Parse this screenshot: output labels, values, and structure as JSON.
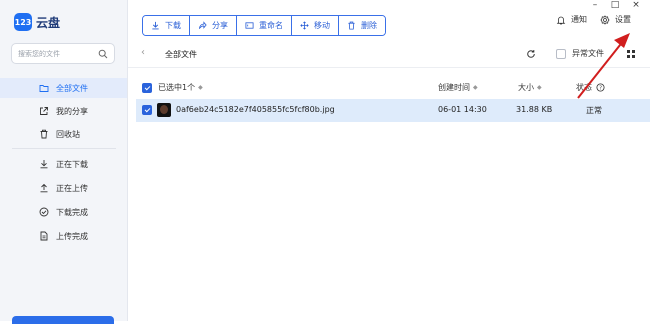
{
  "app": {
    "logo_mark": "123",
    "logo_text": "云盘"
  },
  "search": {
    "placeholder": "搜索您的文件"
  },
  "sidebar": {
    "items": [
      {
        "label": "全部文件",
        "icon": "folder-icon",
        "active": true
      },
      {
        "label": "我的分享",
        "icon": "share-icon"
      },
      {
        "label": "回收站",
        "icon": "trash-icon"
      },
      {
        "label": "正在下载",
        "icon": "download-icon"
      },
      {
        "label": "正在上传",
        "icon": "upload-icon"
      },
      {
        "label": "下载完成",
        "icon": "check-circle-icon"
      },
      {
        "label": "上传完成",
        "icon": "document-icon"
      }
    ]
  },
  "toolbar": {
    "download": "下载",
    "share": "分享",
    "rename": "重命名",
    "move": "移动",
    "delete": "删除"
  },
  "top_right": {
    "notify": "通知",
    "settings": "设置"
  },
  "path": {
    "current": "全部文件",
    "abnormal": "异常文件"
  },
  "list": {
    "selected_label": "已选中1个",
    "col_created": "创建时间",
    "col_size": "大小",
    "col_status": "状态"
  },
  "files": [
    {
      "name": "0af6eb24c5182e7f405855fc5fcf80b.jpg",
      "created": "06-01 14:30",
      "size": "31.88 KB",
      "status": "正常",
      "selected": true
    }
  ],
  "colors": {
    "accent": "#1f6ff2",
    "row_selected": "#deebfb",
    "annotation": "#d11e1e"
  }
}
